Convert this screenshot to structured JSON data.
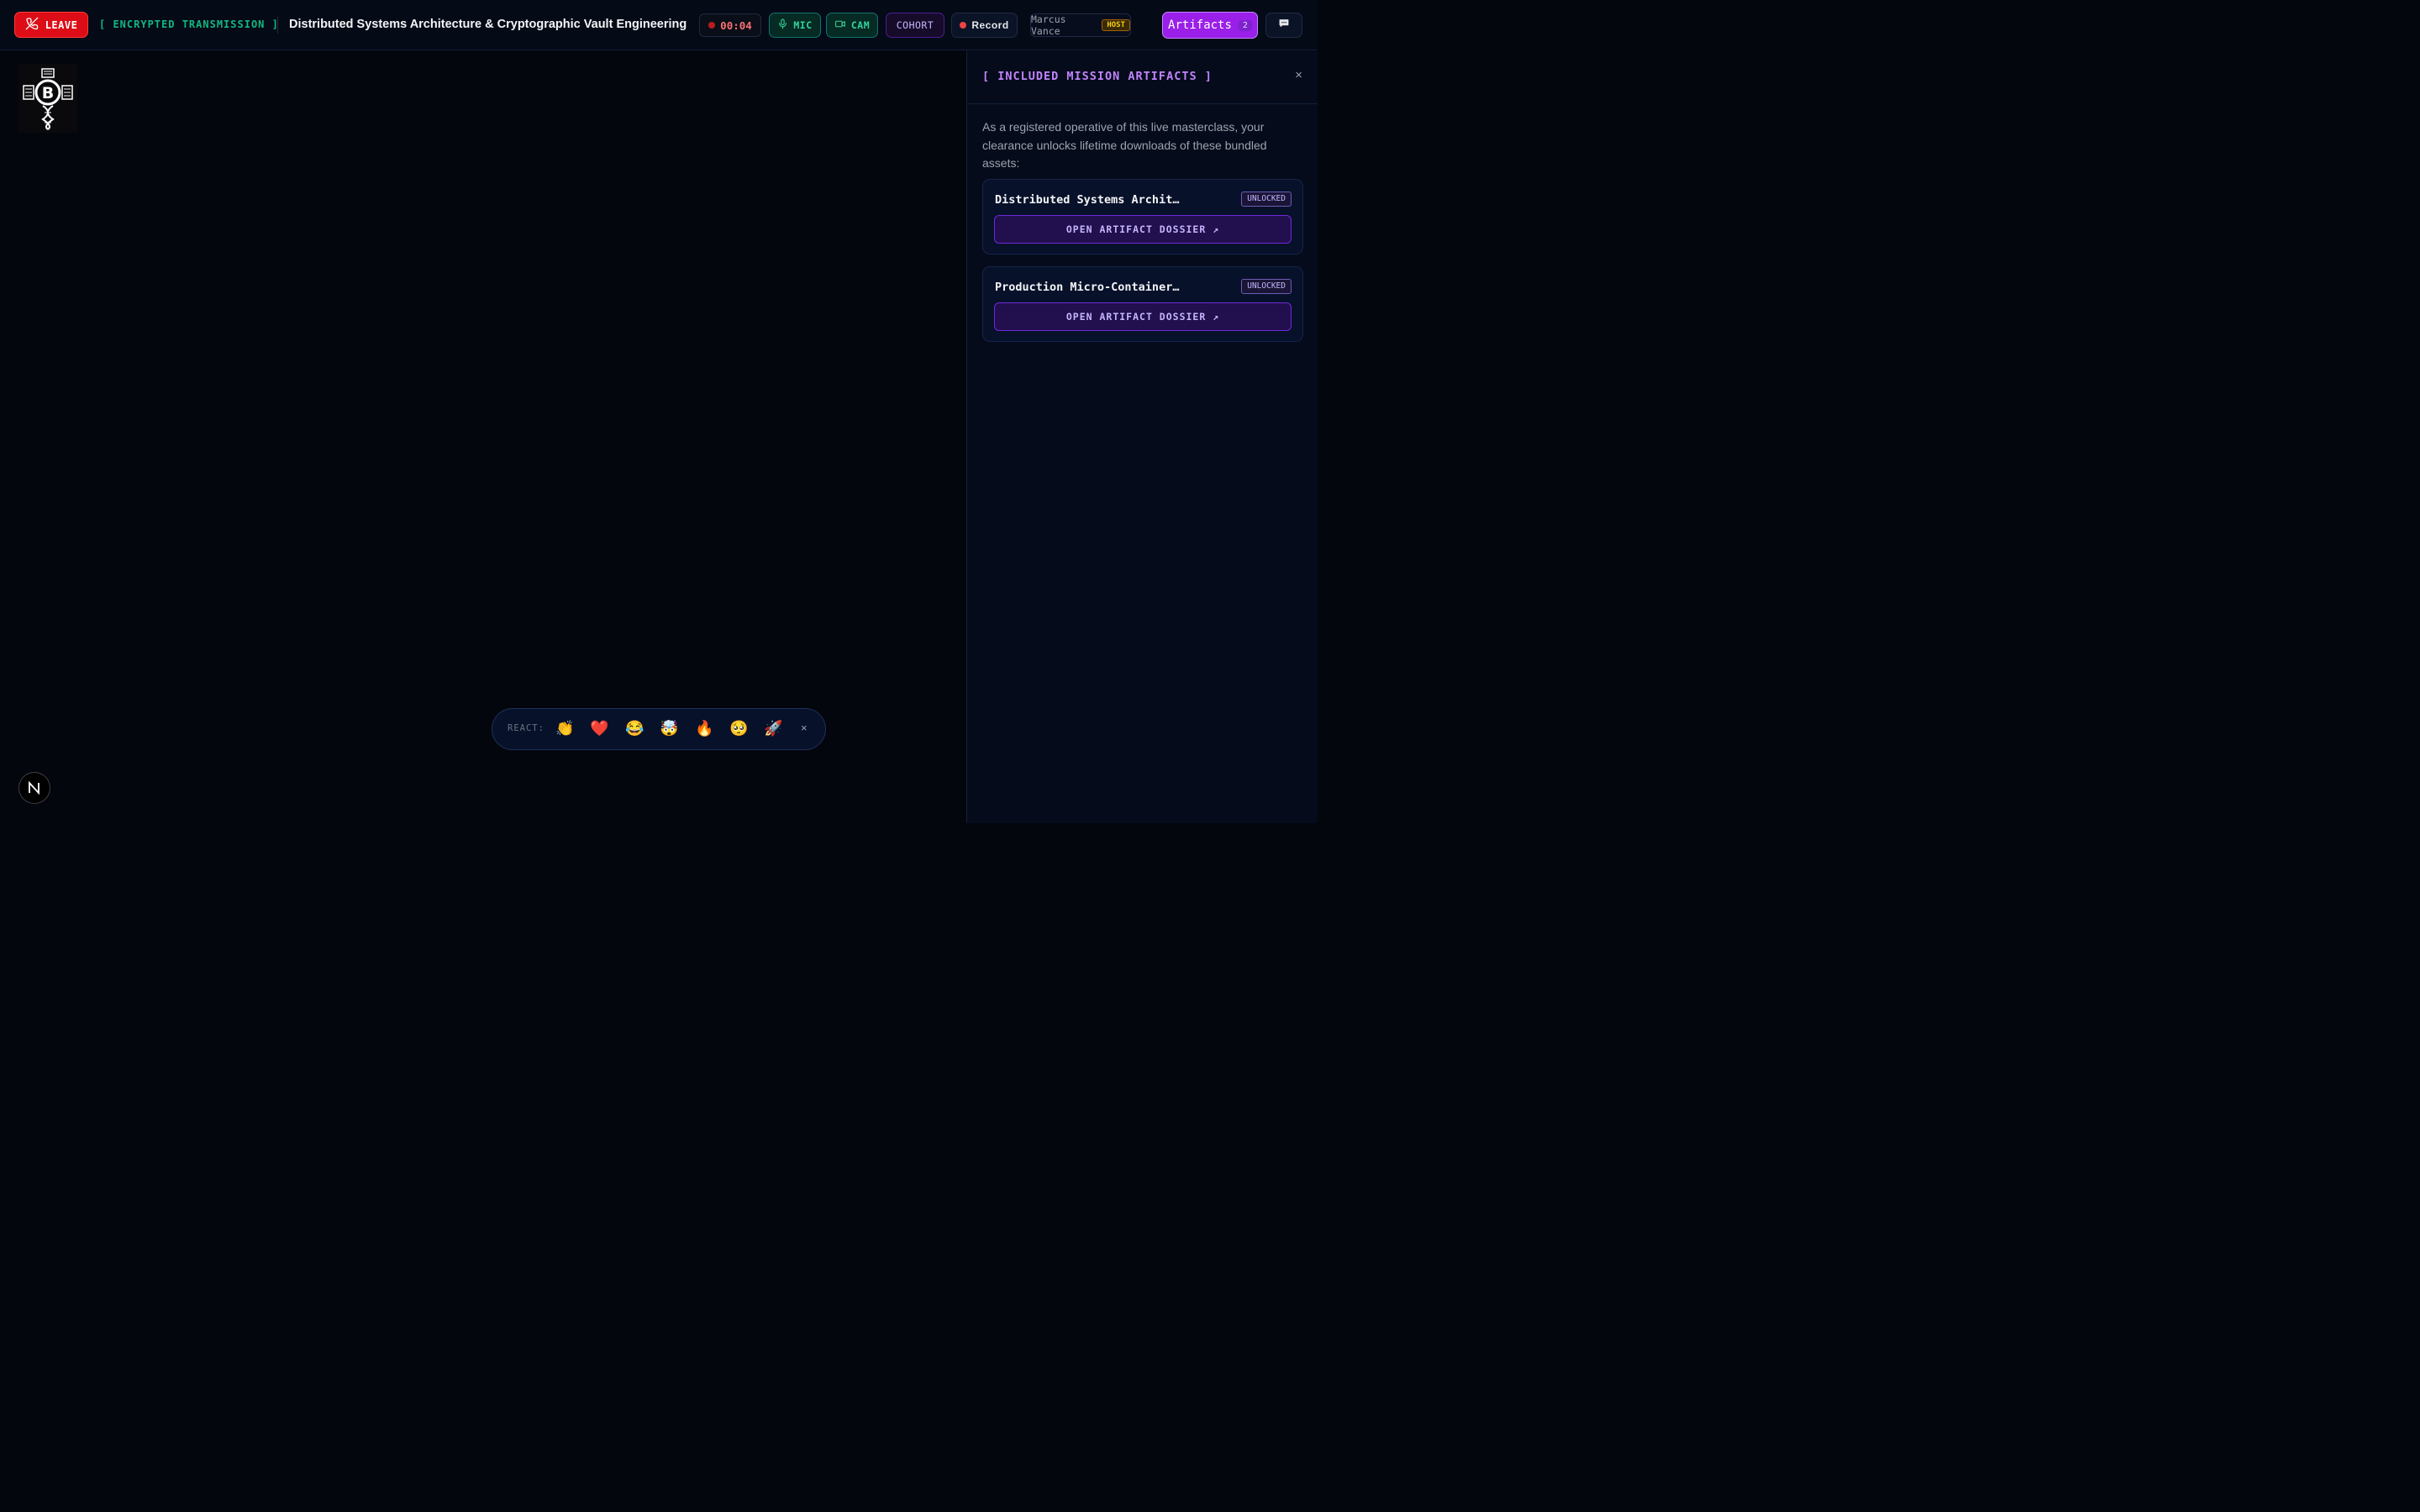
{
  "topbar": {
    "leave_label": "LEAVE",
    "status_label": "[ ENCRYPTED TRANSMISSION ]",
    "session_title": "Distributed Systems Architecture & Cryptographic Vault Engineering",
    "timer": "00:04",
    "mic_label": "MIC",
    "cam_label": "CAM",
    "cohort_label": "COHORT",
    "record_label": "Record",
    "host_name": "Marcus Vance",
    "host_badge": "HOST",
    "artifacts_label": "Artifacts",
    "artifacts_count": "2"
  },
  "panel": {
    "title": "[ INCLUDED MISSION ARTIFACTS ]",
    "close_glyph": "×",
    "description": "As a registered operative of this live masterclass, your clearance unlocks lifetime downloads of these bundled assets:",
    "artifacts": [
      {
        "name": "Distributed Systems Archit…",
        "status": "UNLOCKED",
        "action": "OPEN ARTIFACT DOSSIER ↗"
      },
      {
        "name": "Production Micro-Container…",
        "status": "UNLOCKED",
        "action": "OPEN ARTIFACT DOSSIER ↗"
      }
    ]
  },
  "reactions": {
    "label": "REACT:",
    "emojis": [
      "👏",
      "❤️",
      "😂",
      "🤯",
      "🔥",
      "🥺",
      "🚀"
    ],
    "close_glyph": "×"
  },
  "colors": {
    "background": "#04060d",
    "danger": "#dc0d16",
    "success": "#10b981",
    "accent": "#9a1fe8",
    "host": "#facc15"
  },
  "icons": [
    "phone-off-icon",
    "mic-icon",
    "camera-icon",
    "record-dot-icon",
    "chat-icon",
    "logo-emblem",
    "n-logo-icon"
  ]
}
